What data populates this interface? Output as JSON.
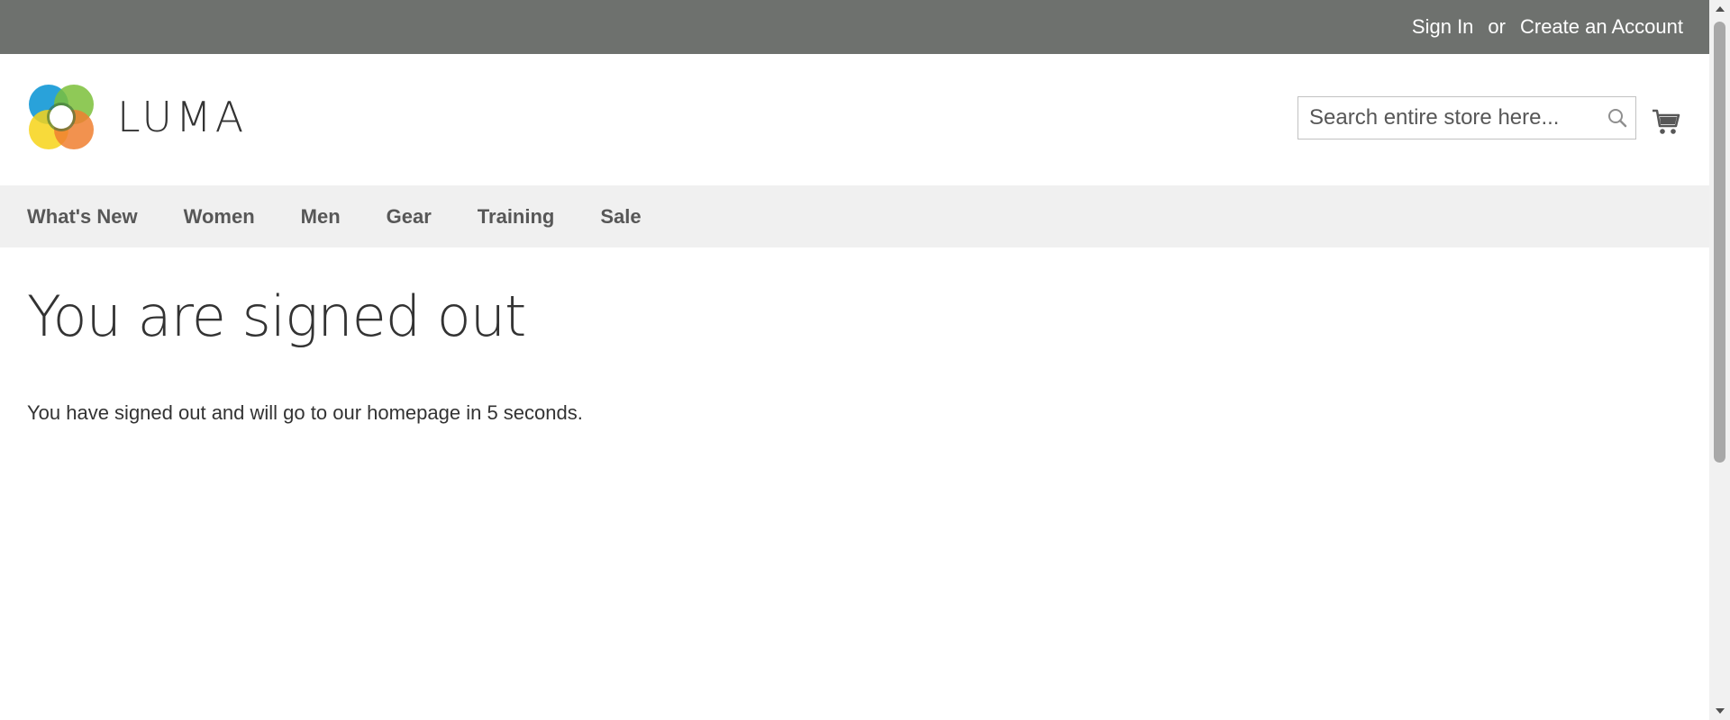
{
  "topbar": {
    "sign_in": "Sign In",
    "or": "or",
    "create_account": "Create an Account"
  },
  "header": {
    "logo_text": "LUMA",
    "search": {
      "placeholder": "Search entire store here...",
      "value": ""
    },
    "icons": {
      "search": "search-icon",
      "cart": "cart-icon"
    }
  },
  "nav": {
    "items": [
      "What's New",
      "Women",
      "Men",
      "Gear",
      "Training",
      "Sale"
    ]
  },
  "main": {
    "title": "You are signed out",
    "message": "You have signed out and will go to our homepage in 5 seconds."
  },
  "colors": {
    "topbar": "#6e716e",
    "nav_bg": "#f0f0f0",
    "text": "#333333"
  }
}
